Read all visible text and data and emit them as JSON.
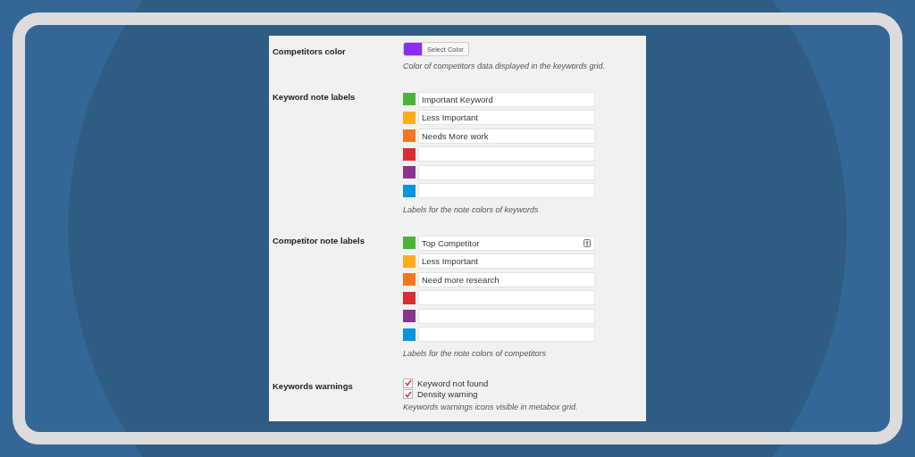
{
  "competitors_color": {
    "label": "Competitors color",
    "color": "#8a2cf5",
    "button": "Select Color",
    "description": "Color of competitors data displayed in the keywords grid."
  },
  "keyword_note_labels": {
    "label": "Keyword note labels",
    "items": [
      {
        "color": "#4fb33b",
        "value": "Important Keyword",
        "alert_icon": false
      },
      {
        "color": "#fbac1f",
        "value": "Less Important",
        "alert_icon": false
      },
      {
        "color": "#f47621",
        "value": "Needs More work",
        "alert_icon": false
      },
      {
        "color": "#de2b34",
        "value": "",
        "alert_icon": false
      },
      {
        "color": "#8a3390",
        "value": "",
        "alert_icon": false
      },
      {
        "color": "#0a94dc",
        "value": "",
        "alert_icon": false
      }
    ],
    "description": "Labels for the note colors of keywords"
  },
  "competitor_note_labels": {
    "label": "Competitor note labels",
    "items": [
      {
        "color": "#4fb33b",
        "value": "Top Competitor",
        "alert_icon": true
      },
      {
        "color": "#fbac1f",
        "value": "Less Important",
        "alert_icon": false
      },
      {
        "color": "#f47621",
        "value": "Need more research",
        "alert_icon": false
      },
      {
        "color": "#de2b34",
        "value": "",
        "alert_icon": false
      },
      {
        "color": "#8a3390",
        "value": "",
        "alert_icon": false
      },
      {
        "color": "#0a94dc",
        "value": "",
        "alert_icon": false
      }
    ],
    "description": "Labels for the note colors of competitors"
  },
  "keywords_warnings": {
    "label": "Keywords warnings",
    "options": [
      {
        "label": "Keyword not found",
        "checked": true
      },
      {
        "label": "Density warning",
        "checked": true
      }
    ],
    "description": "Keywords warnings icons visible in metabox grid."
  }
}
